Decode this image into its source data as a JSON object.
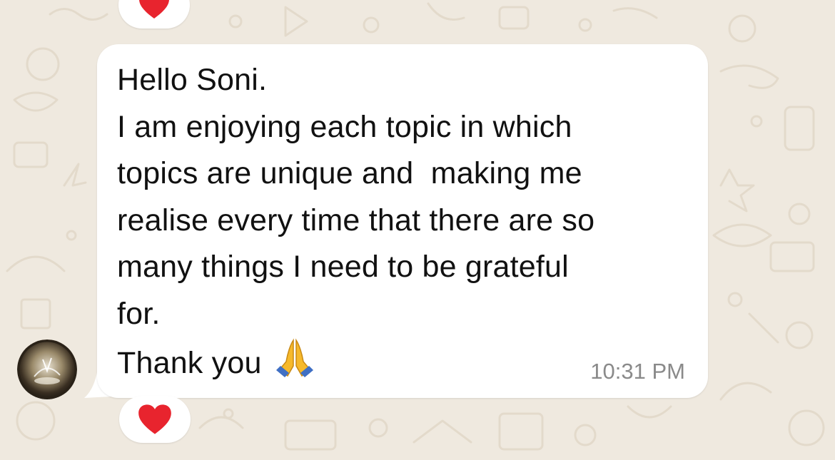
{
  "message": {
    "lines": [
      "Hello Soni.",
      "I am enjoying each topic in which",
      "topics are unique and  making me",
      "realise every time that there are so",
      "many things I need to be grateful",
      "for.",
      "Thank you"
    ],
    "emoji": "folded-hands",
    "time": "10:31 PM"
  },
  "reactions": {
    "top": "red-heart",
    "bottom": "red-heart"
  },
  "colors": {
    "background": "#efe9df",
    "bubble": "#ffffff",
    "timestamp": "#8a8a8a",
    "heart": "#e8242e"
  }
}
